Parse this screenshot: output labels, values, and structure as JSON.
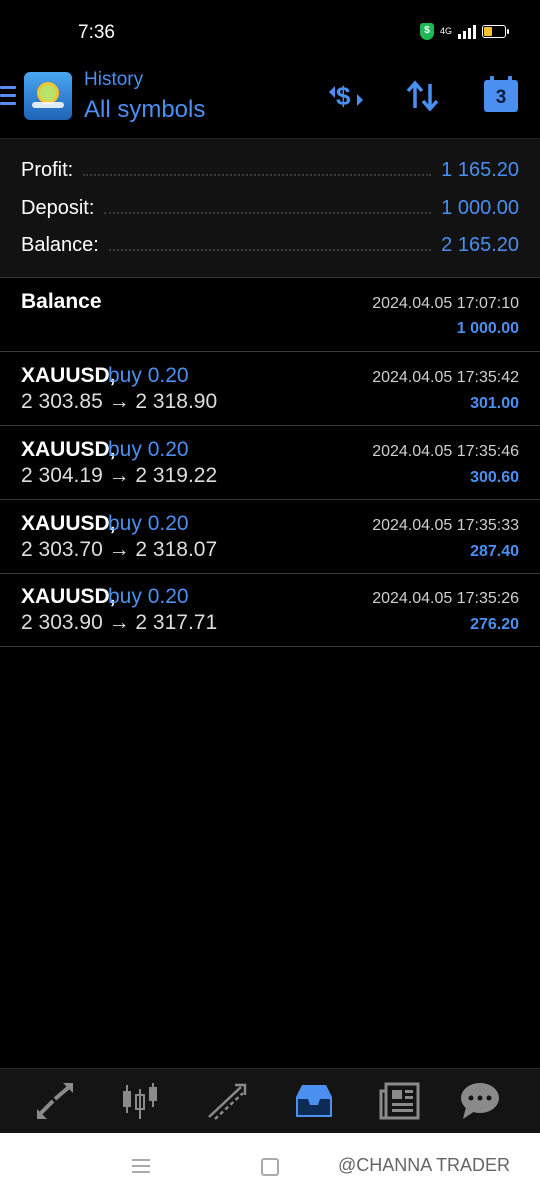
{
  "status": {
    "time": "7:36",
    "network": "4G"
  },
  "header": {
    "subtitle": "History",
    "title": "All symbols",
    "calendar_value": "3"
  },
  "summary": {
    "profit_label": "Profit:",
    "profit_value": "1 165.20",
    "deposit_label": "Deposit:",
    "deposit_value": "1 000.00",
    "balance_label": "Balance:",
    "balance_value": "2 165.20"
  },
  "balance_op": {
    "label": "Balance",
    "time": "2024.04.05 17:07:10",
    "amount": "1 000.00"
  },
  "deals": [
    {
      "symbol": "XAUUSD,",
      "type": "buy 0.20",
      "prices": "2 303.85 → 2 318.90",
      "time": "2024.04.05 17:35:42",
      "profit": "301.00"
    },
    {
      "symbol": "XAUUSD,",
      "type": "buy 0.20",
      "prices": "2 304.19 → 2 319.22",
      "time": "2024.04.05 17:35:46",
      "profit": "300.60"
    },
    {
      "symbol": "XAUUSD,",
      "type": "buy 0.20",
      "prices": "2 303.70 → 2 318.07",
      "time": "2024.04.05 17:35:33",
      "profit": "287.40"
    },
    {
      "symbol": "XAUUSD,",
      "type": "buy 0.20",
      "prices": "2 303.90 → 2 317.71",
      "time": "2024.04.05 17:35:26",
      "profit": "276.20"
    }
  ],
  "watermark": "@CHANNA TRADER",
  "colors": {
    "accent": "#4b8ff0",
    "background": "#000000",
    "summary_bg": "#121212"
  }
}
